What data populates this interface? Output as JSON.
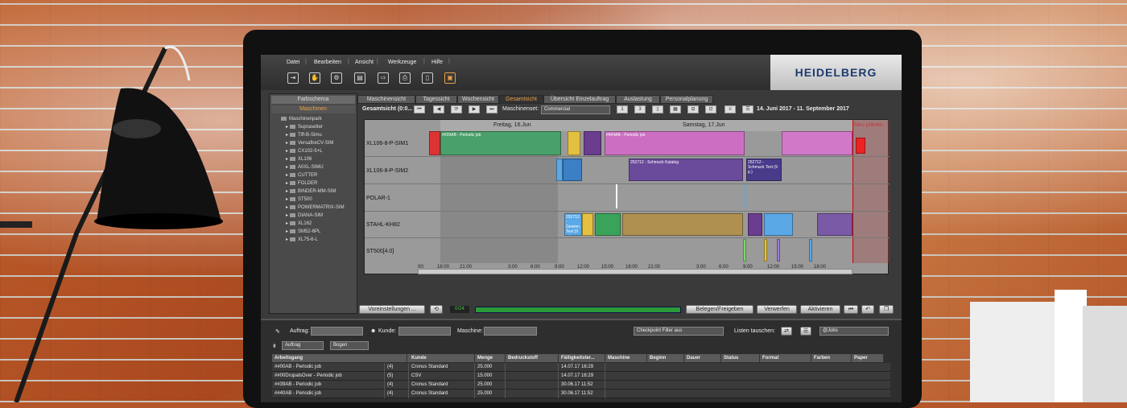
{
  "menu": [
    "Datei",
    "Bearbeiten",
    "Ansicht",
    "Werkzeuge",
    "Hilfe"
  ],
  "toolbar_icons": [
    "import-icon",
    "hand-icon",
    "settings-icon",
    "machine-icon",
    "export-icon",
    "print-icon",
    "document-icon",
    "job-icon"
  ],
  "logo": "HEIDELBERG",
  "left": {
    "farbschema": "Farbschema",
    "maschinen": "Maschinen",
    "root": "Maschinenpark",
    "items": [
      "Suprasetter",
      "Tiff-B-Simu",
      "VersafireCV-SIM",
      "CX102-5+L",
      "XL106",
      "A0XL-SIMU",
      "CUTTER",
      "FOLDER",
      "BINDER-MM-SIM",
      "ST500",
      "POWERMATRIX-SIM",
      "DIANA-SIM",
      "XL162",
      "SM52-6PL",
      "XL75-6-L"
    ]
  },
  "tabs": [
    "Maschinensicht",
    "Tagessicht",
    "Wochensicht",
    "Gesamtsicht",
    "Übersicht Einzelauftrag",
    "Auslastung",
    "Personalplanung"
  ],
  "control": {
    "view_label": "Gesamtsicht  (0:0...",
    "maschinenset_label": "Maschinenset:",
    "maschinenset_value": "Commercial",
    "btn1": "1",
    "btn2": "3",
    "date_range": "14. Juni 2017  -  11. September 2017"
  },
  "gantt": {
    "day1": "Freitag, 16.Jun",
    "day2": "Samstag, 17.Jun",
    "neu": "Neu planen",
    "rows": [
      "XL106-8-P-SIM1",
      "XL106-8-P-SIM2",
      "POLAR-1",
      "STAHL-KH82",
      "ST500[4.0]"
    ],
    "axis": [
      "00:",
      "18:00",
      "21:00",
      "3:00",
      "6:00",
      "9:00",
      "12:00",
      "15:00",
      "18:00",
      "21:00",
      "3:00",
      "6:00",
      "9:00",
      "12:00",
      "15:00",
      "18:00"
    ],
    "bar_labels": [
      "##04AB - Periodic job",
      "##39AB - Periodic job",
      "252712 - Schmuck Katalog",
      "252712 - Schmuck Text (9 p.)",
      "252713 - Gewinn. Text (9 p.)"
    ]
  },
  "bottom": {
    "voreinstellungen": "Voreinstellungen ...",
    "counter": "0/24",
    "belegen": "Belegen/Freigeben",
    "verwerfen": "Verwerfen",
    "aktivieren": "Aktivieren",
    "progress": 1.0
  },
  "filter": {
    "auftrag": "Auftrag:",
    "kunde": "Kunde:",
    "maschine": "Maschine:",
    "checkpoint": "Checkpoint Filter aus",
    "listen": "Listen tauschen:",
    "jobs": "@Jobs",
    "group1": "Auftrag",
    "group2": "Bogen"
  },
  "columns": [
    "Arbeitsgang",
    "",
    "Kunde",
    "Menge",
    "Bedruckstoff",
    "Fälligkeitster...",
    "Maschine",
    "Beginn",
    "Dauer",
    "Status",
    "Format",
    "Farben",
    "Paper"
  ],
  "rows": [
    {
      "name": "##00AB - Periodic job",
      "n": "(4)",
      "kunde": "Cronus Standard",
      "menge": "25.000",
      "faellig": "14.07.17 16:29"
    },
    {
      "name": "##00DrupalsOver - Periodic job",
      "n": "(5)",
      "kunde": "CSV",
      "menge": "15.000",
      "faellig": "14.07.17 16:29"
    },
    {
      "name": "##39AB - Periodic job",
      "n": "(4)",
      "kunde": "Cronus Standard",
      "menge": "25.000",
      "faellig": "30.06.17 11:52"
    },
    {
      "name": "##40AB - Periodic job",
      "n": "(4)",
      "kunde": "Cronus Standard",
      "menge": "25.000",
      "faellig": "30.06.17 11:52"
    }
  ]
}
